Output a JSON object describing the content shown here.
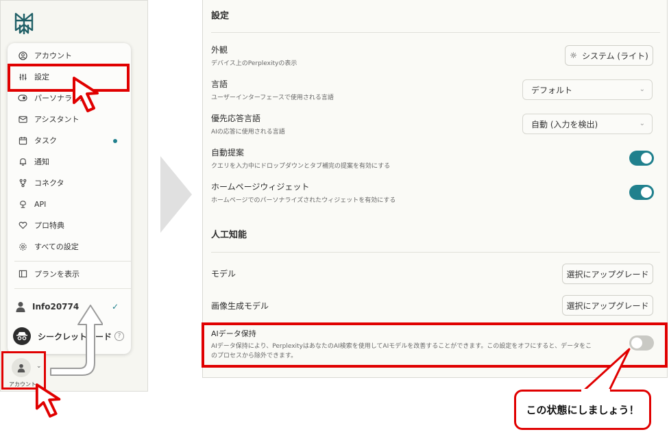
{
  "sidebar": {
    "menu": [
      {
        "label": "アカウント",
        "icon": "user-circle-icon"
      },
      {
        "label": "設定",
        "icon": "sliders-icon"
      },
      {
        "label": "パーソナライズ",
        "icon": "toggle-icon"
      },
      {
        "label": "アシスタント",
        "icon": "mail-icon"
      },
      {
        "label": "タスク",
        "icon": "calendar-icon"
      },
      {
        "label": "通知",
        "icon": "bell-icon"
      },
      {
        "label": "コネクタ",
        "icon": "connector-icon"
      },
      {
        "label": "API",
        "icon": "api-icon"
      },
      {
        "label": "プロ特典",
        "icon": "heart-icon"
      },
      {
        "label": "すべての設定",
        "icon": "gear-icon"
      }
    ],
    "plan_label": "プランを表示",
    "user_name": "Info20774",
    "incognito_label": "シークレットモード",
    "account_label": "アカウント"
  },
  "settings": {
    "title": "設定",
    "rows": [
      {
        "title": "外観",
        "subtitle": "デバイス上のPerplexityの表示",
        "button": "システム (ライト)"
      },
      {
        "title": "言語",
        "subtitle": "ユーザーインターフェースで使用される言語",
        "select": "デフォルト"
      },
      {
        "title": "優先応答言語",
        "subtitle": "AIの応答に使用される言語",
        "select": "自動 (入力を検出)"
      },
      {
        "title": "自動提案",
        "subtitle": "クエリを入力中にドロップダウンとタブ補完の提案を有効にする"
      },
      {
        "title": "ホームページウィジェット",
        "subtitle": "ホームページでのパーソナライズされたウィジェットを有効にする"
      }
    ],
    "ai_title": "人工知能",
    "model_label": "モデル",
    "model_button": "選択にアップグレード",
    "image_model_label": "画像生成モデル",
    "image_model_button": "選択にアップグレード",
    "retention_title": "AIデータ保持",
    "retention_desc_1": "AIデータ保持により、PerplexityはあなたのAI検索を使用してAIモデルを改善することができます。この設定をオフにすると、データをこ",
    "retention_desc_2": "のプロセスから除外できます。"
  },
  "callout": "この状態にしましょう！",
  "colors": {
    "accent": "#20808d",
    "highlight": "#e00000"
  }
}
